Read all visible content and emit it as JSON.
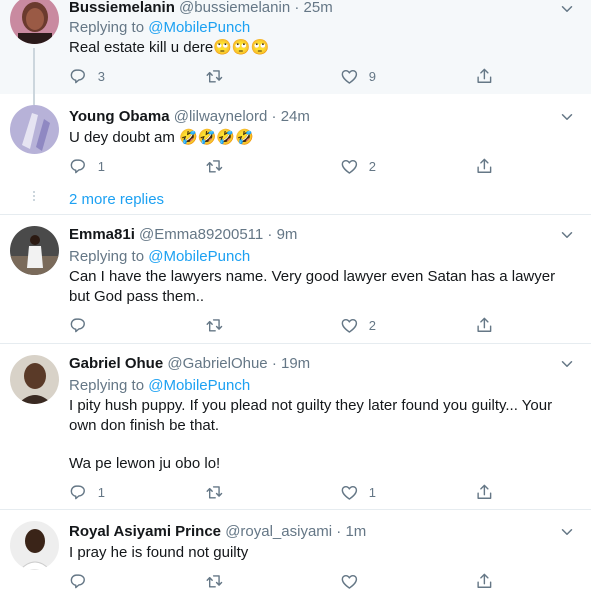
{
  "tweets": [
    {
      "name": "Bussiemelanin",
      "handle": "@bussiemelanin",
      "time": "25m",
      "replying_label": "Replying to ",
      "replying_to": "@MobilePunch",
      "text": "Real estate kill u dere🙄🙄🙄",
      "reply_count": "3",
      "retweet_count": "",
      "like_count": "9"
    },
    {
      "name": "Young Obama",
      "handle": "@lilwaynelord",
      "time": "24m",
      "text": "U dey doubt am 🤣🤣🤣🤣",
      "reply_count": "1",
      "retweet_count": "",
      "like_count": "2"
    },
    {
      "name": "Emma81i",
      "handle": "@Emma89200511",
      "time": "9m",
      "replying_label": "Replying to ",
      "replying_to": "@MobilePunch",
      "text": "Can I have the lawyers name. Very good lawyer even Satan has a lawyer but God pass them..",
      "reply_count": "",
      "retweet_count": "",
      "like_count": "2"
    },
    {
      "name": "Gabriel Ohue",
      "handle": "@GabrielOhue",
      "time": "19m",
      "replying_label": "Replying to ",
      "replying_to": "@MobilePunch",
      "text": "I pity hush puppy. If you plead not guilty they later found you guilty... Your own don finish be that.",
      "text2": "Wa pe lewon ju obo lo!",
      "reply_count": "1",
      "retweet_count": "",
      "like_count": "1"
    },
    {
      "name": "Royal Asiyami Prince",
      "handle": "@royal_asiyami",
      "time": "1m",
      "text": "I pray he is found not guilty",
      "reply_count": "",
      "retweet_count": "",
      "like_count": ""
    }
  ],
  "more_replies": "2 more replies",
  "separator": "·",
  "colors": {
    "accent": "#1da1f2",
    "muted": "#657786",
    "text": "#14171a",
    "thread": "#ccd6dd"
  },
  "icons": [
    "reply-icon",
    "retweet-icon",
    "like-icon",
    "share-icon",
    "chevron-down-icon"
  ]
}
